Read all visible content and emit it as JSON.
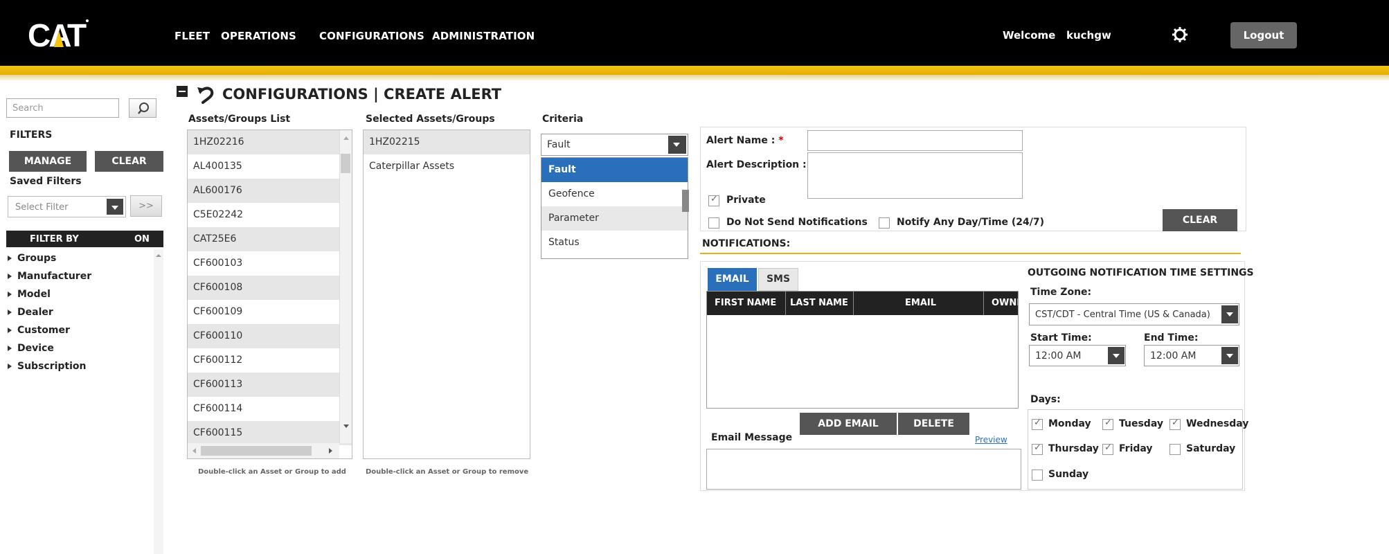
{
  "nav": {
    "items": [
      "FLEET",
      "OPERATIONS",
      "CONFIGURATIONS",
      "ADMINISTRATION"
    ],
    "welcome": "Welcome",
    "username": "kuchgw",
    "logout": "Logout"
  },
  "sidebar": {
    "search_placeholder": "Search",
    "filters_title": "FILTERS",
    "manage_label": "MANAGE",
    "clear_label": "CLEAR",
    "saved_filters_title": "Saved Filters",
    "select_filter_value": "Select Filter",
    "go_label": ">>",
    "filter_by_label": "FILTER BY",
    "on_label": "ON",
    "filter_items": [
      "Groups",
      "Manufacturer",
      "Model",
      "Dealer",
      "Customer",
      "Device",
      "Subscription"
    ]
  },
  "page": {
    "title": "CONFIGURATIONS | CREATE ALERT"
  },
  "assets": {
    "heading": "Assets/Groups List",
    "items": [
      "1HZ02216",
      "AL400135",
      "AL600176",
      "C5E02242",
      "CAT25E6",
      "CF600103",
      "CF600108",
      "CF600109",
      "CF600110",
      "CF600112",
      "CF600113",
      "CF600114",
      "CF600115"
    ],
    "hint": "Double-click an Asset or Group to add"
  },
  "selected": {
    "heading": "Selected Assets/Groups",
    "items": [
      "1HZ02215",
      "Caterpillar Assets"
    ],
    "hint": "Double-click an Asset or Group to remove"
  },
  "criteria": {
    "heading": "Criteria",
    "value": "Fault",
    "options": [
      "Fault",
      "Geofence",
      "Parameter",
      "Status"
    ]
  },
  "form": {
    "alert_name_label": "Alert Name :",
    "alert_desc_label": "Alert Description :",
    "required_mark": "*",
    "private_label": "Private",
    "private_checked": true,
    "no_notify_label": "Do Not Send Notifications",
    "no_notify_checked": false,
    "any_time_label": "Notify Any Day/Time (24/7)",
    "any_time_checked": false,
    "clear_label": "CLEAR"
  },
  "notifications": {
    "title": "NOTIFICATIONS:",
    "tabs": [
      "EMAIL",
      "SMS"
    ],
    "columns": [
      "FIRST NAME",
      "LAST NAME",
      "EMAIL",
      "OWNI"
    ],
    "add_email_label": "ADD EMAIL",
    "delete_label": "DELETE",
    "email_message_label": "Email Message",
    "preview_label": "Preview"
  },
  "outgoing": {
    "title": "OUTGOING NOTIFICATION TIME SETTINGS",
    "tz_label": "Time Zone:",
    "tz_value": "CST/CDT - Central Time (US & Canada)",
    "start_label": "Start Time:",
    "start_value": "12:00 AM",
    "end_label": "End Time:",
    "end_value": "12:00 AM",
    "days_label": "Days:",
    "days": [
      {
        "name": "Monday",
        "checked": true
      },
      {
        "name": "Tuesday",
        "checked": true
      },
      {
        "name": "Wednesday",
        "checked": true
      },
      {
        "name": "Thursday",
        "checked": true
      },
      {
        "name": "Friday",
        "checked": true
      },
      {
        "name": "Saturday",
        "checked": false
      },
      {
        "name": "Sunday",
        "checked": false
      }
    ]
  },
  "colors": {
    "topbar": "#000000",
    "accent_yellow": "#f6c40e",
    "selection_blue": "#2a6fb9",
    "button_gray": "#555555"
  }
}
